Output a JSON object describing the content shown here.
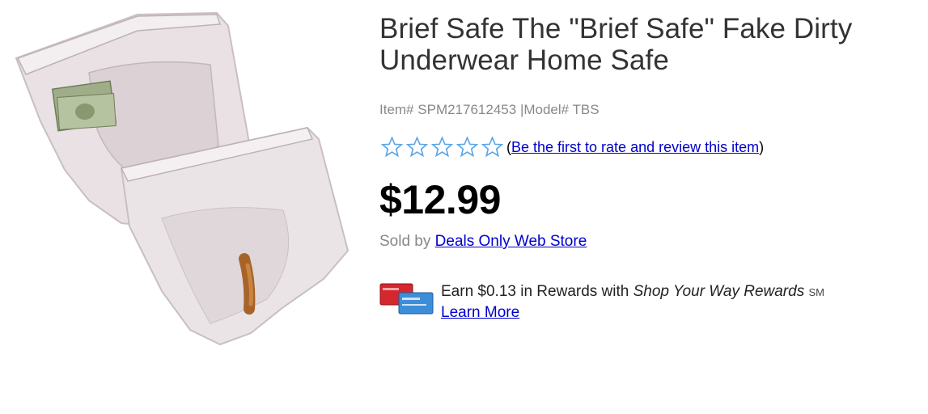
{
  "product": {
    "title": "Brief Safe The \"Brief Safe\" Fake Dirty Underwear Home Safe",
    "item_label": "Item#",
    "item_number": "SPM217612453",
    "model_label": "|Model#",
    "model_number": "TBS",
    "rating": {
      "stars": 0,
      "max_stars": 5,
      "open_paren": "(",
      "link_text": "Be the first to rate and review this item",
      "close_paren": ")"
    },
    "price": "$12.99",
    "seller": {
      "prefix": "Sold by",
      "name": "Deals Only Web Store"
    },
    "rewards": {
      "earn_text": "Earn $0.13 in Rewards with",
      "program_name": "Shop Your Way Rewards",
      "sm_mark": "SM",
      "learn_more": "Learn More"
    }
  },
  "colors": {
    "link": "#0000cc",
    "muted_text": "#888888",
    "title_text": "#333333",
    "star_outline": "#5aa5e6"
  },
  "icons": {
    "rating_star": "star-outline-icon",
    "rewards_cards": "credit-cards-icon"
  }
}
